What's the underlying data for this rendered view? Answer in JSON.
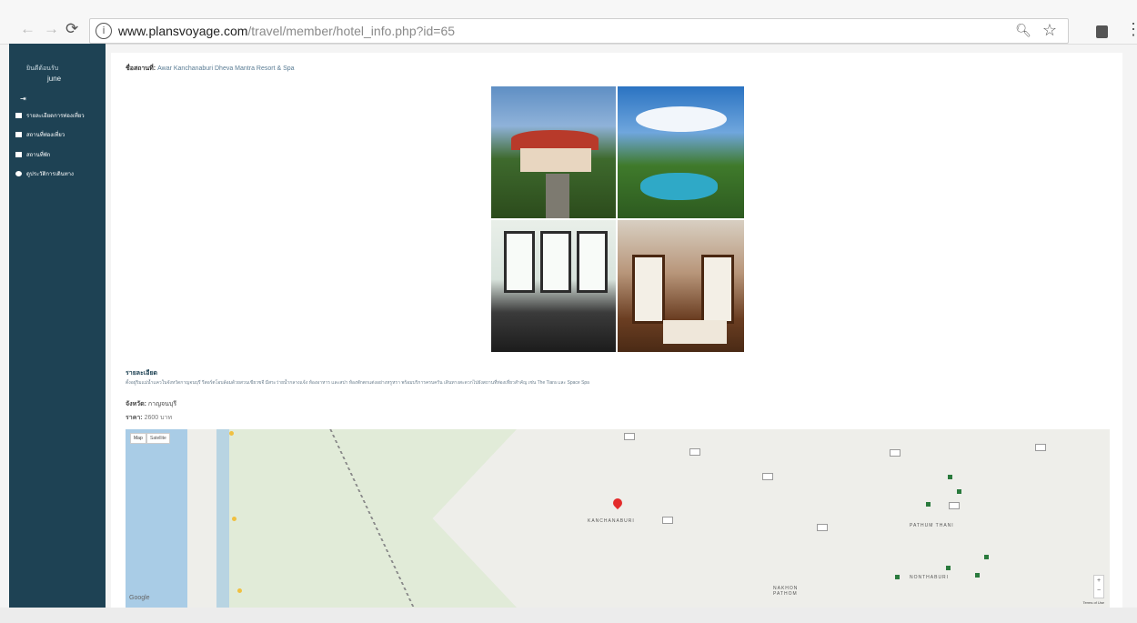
{
  "browser": {
    "url_host": "www.plansvoyage.com",
    "url_path": "/travel/member/hotel_info.php?id=65"
  },
  "sidebar": {
    "user_label": "ยินดีต้อนรับ",
    "user_name": "june",
    "items": [
      {
        "label": "รายละเอียดการท่องเที่ยว"
      },
      {
        "label": "สถานที่ท่องเที่ยว"
      },
      {
        "label": "สถานที่พัก"
      },
      {
        "label": "ดูประวัติการเดินทาง"
      }
    ]
  },
  "hotel": {
    "title_label": "ชื่อสถานที่:",
    "name": "Awar Kanchanaburi Dheva Mantra Resort & Spa",
    "detail_heading": "รายละเอียด",
    "detail_text": "ตั้งอยู่ริมแม่น้ำแควในจังหวัดกาญจนบุรี รีสอร์ตโอบล้อมด้วยสวนเขียวขจี มีสระว่ายน้ำกลางแจ้ง ห้องอาหาร และสปา ห้องพักตกแต่งอย่างหรูหรา พร้อมบริการครบครัน เดินทางสะดวกไปยังสถานที่ท่องเที่ยวสำคัญ เช่น The Tiara และ Space Spa",
    "province_label": "จังหวัด:",
    "province": "กาญจนบุรี",
    "price_label": "ราคา:",
    "price": "2600 บาท"
  },
  "map": {
    "tab_map": "Map",
    "tab_satellite": "Satellite",
    "city_main": "KANCHANABURI",
    "city_nakhon": "NAKHON PATHOM",
    "city_pathum": "PATHUM THANI",
    "city_nonthaburi": "NONTHABURI",
    "google": "Google",
    "terms": "Terms of Use"
  }
}
